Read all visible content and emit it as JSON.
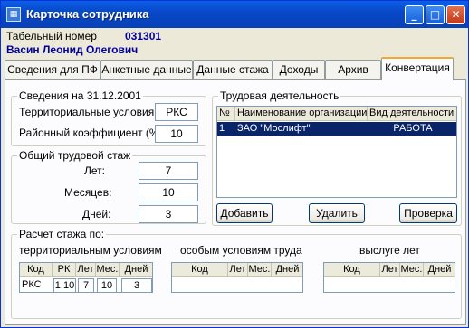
{
  "window": {
    "title": "Карточка сотрудника",
    "minimize_glyph": "_",
    "maximize_glyph": "□",
    "close_glyph": "✕"
  },
  "header": {
    "tab_number_label": "Табельный номер",
    "tab_number_value": "031301",
    "employee_name": "Васин Леонид Олегович"
  },
  "tabs": [
    {
      "label": "Сведения для ПФ"
    },
    {
      "label": "Анкетные данные"
    },
    {
      "label": "Данные стажа"
    },
    {
      "label": "Доходы"
    },
    {
      "label": "Архив"
    },
    {
      "label": "Конвертация",
      "active": true
    }
  ],
  "info": {
    "group_label": "Сведения на 31.12.2001",
    "territorial_label": "Территориальные условия:",
    "territorial_value": "РКС",
    "coef_label": "Районный коэффициент (%):",
    "coef_value": "10"
  },
  "total": {
    "group_label": "Общий трудовой стаж",
    "years_label": "Лет:",
    "years_value": "7",
    "months_label": "Месяцев:",
    "months_value": "10",
    "days_label": "Дней:",
    "days_value": "3"
  },
  "work": {
    "group_label": "Трудовая деятельность",
    "columns": [
      "№",
      "Наименование организации",
      "Вид деятельности"
    ],
    "rows": [
      {
        "num": "1",
        "org": "ЗАО \"Мослифт\"",
        "kind": "РАБОТА"
      }
    ],
    "add_button": "Добавить",
    "delete_button": "Удалить",
    "check_button": "Проверка"
  },
  "calc": {
    "group_label": "Расчет стажа по:",
    "territorial": {
      "label": "территориальным условиям",
      "columns": [
        "Код",
        "РК",
        "Лет",
        "Мес.",
        "Дней"
      ],
      "row": [
        "РКС",
        "1.10",
        "7",
        "10",
        "3"
      ]
    },
    "special": {
      "label": "особым условиям труда",
      "columns": [
        "Код",
        "Лет",
        "Мес.",
        "Дней"
      ]
    },
    "seniority": {
      "label": "выслуге лет",
      "columns": [
        "Код",
        "Лет",
        "Мес.",
        "Дней"
      ]
    }
  }
}
